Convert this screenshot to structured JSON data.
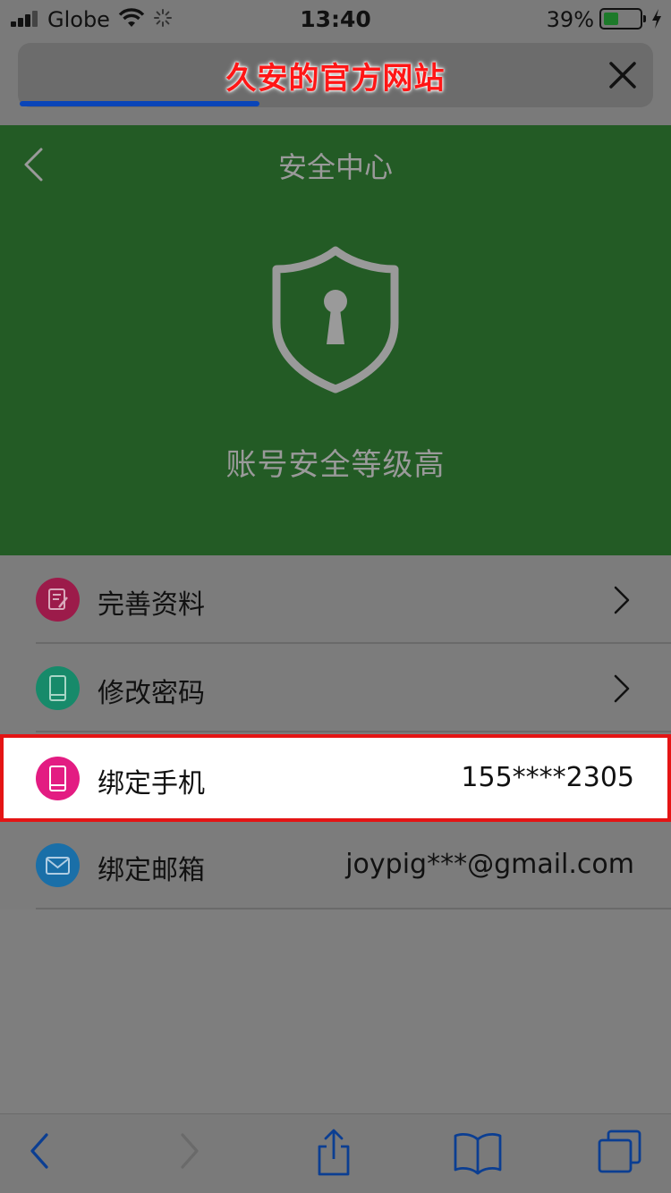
{
  "status_bar": {
    "carrier": "Globe",
    "time": "13:40",
    "battery_percent": "39%",
    "battery_level": 0.39
  },
  "address_bar": {
    "title": "久安的官方网站",
    "load_progress": 0.38
  },
  "header": {
    "title": "安全中心",
    "security_level": "账号安全等级高"
  },
  "colors": {
    "header_green": "#235b25",
    "profile_icon": "#9c1b4a",
    "password_icon": "#178a6a",
    "phone_icon": "#e31c82",
    "email_icon": "#1a6fa8",
    "highlight_border": "#e41414"
  },
  "menu": [
    {
      "label": "完善资料",
      "value": "",
      "icon": "edit-icon",
      "chevron": true
    },
    {
      "label": "修改密码",
      "value": "",
      "icon": "phone-icon",
      "chevron": true
    },
    {
      "label": "绑定手机",
      "value": "155****2305",
      "icon": "phone-icon",
      "chevron": false,
      "highlighted": true
    },
    {
      "label": "绑定邮箱",
      "value": "joypig***@gmail.com",
      "icon": "mail-icon",
      "chevron": false
    }
  ],
  "toolbar": {
    "icons": [
      "back-icon",
      "forward-icon",
      "share-icon",
      "bookmarks-icon",
      "tabs-icon"
    ]
  }
}
